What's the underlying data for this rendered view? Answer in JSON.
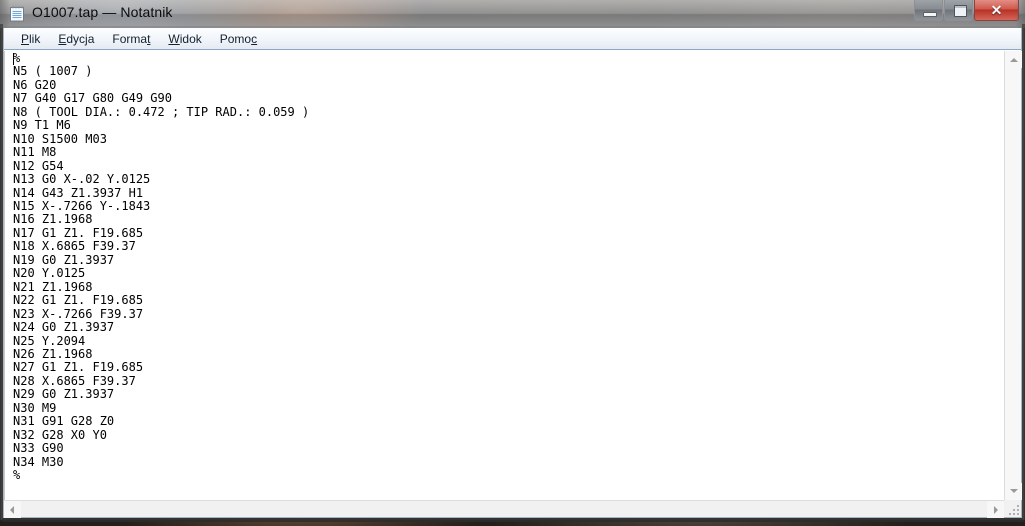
{
  "window": {
    "title": "O1007.tap — Notatnik",
    "icon": "notepad-icon",
    "caption_buttons": [
      {
        "name": "minimize",
        "label": "—"
      },
      {
        "name": "maximize",
        "label": "□"
      },
      {
        "name": "close",
        "label": "✕"
      }
    ]
  },
  "menubar": {
    "items": [
      {
        "label": "Plik",
        "mnemonic": "P"
      },
      {
        "label": "Edycja",
        "mnemonic": "E"
      },
      {
        "label": "Format",
        "mnemonic": "t"
      },
      {
        "label": "Widok",
        "mnemonic": "W"
      },
      {
        "label": "Pomoc",
        "mnemonic": "c"
      }
    ]
  },
  "editor": {
    "content": "%\nN5 ( 1007 )\nN6 G20\nN7 G40 G17 G80 G49 G90\nN8 ( TOOL DIA.: 0.472 ; TIP RAD.: 0.059 )\nN9 T1 M6\nN10 S1500 M03\nN11 M8\nN12 G54\nN13 G0 X-.02 Y.0125\nN14 G43 Z1.3937 H1\nN15 X-.7266 Y-.1843\nN16 Z1.1968\nN17 G1 Z1. F19.685\nN18 X.6865 F39.37\nN19 G0 Z1.3937\nN20 Y.0125\nN21 Z1.1968\nN22 G1 Z1. F19.685\nN23 X-.7266 F39.37\nN24 G0 Z1.3937\nN25 Y.2094\nN26 Z1.1968\nN27 G1 Z1. F19.685\nN28 X.6865 F39.37\nN29 G0 Z1.3937\nN30 M9\nN31 G91 G28 Z0\nN32 G28 X0 Y0\nN33 G90\nN34 M30\n%",
    "lines": [
      "%",
      "N5 ( 1007 )",
      "N6 G20",
      "N7 G40 G17 G80 G49 G90",
      "N8 ( TOOL DIA.: 0.472 ; TIP RAD.: 0.059 )",
      "N9 T1 M6",
      "N10 S1500 M03",
      "N11 M8",
      "N12 G54",
      "N13 G0 X-.02 Y.0125",
      "N14 G43 Z1.3937 H1",
      "N15 X-.7266 Y-.1843",
      "N16 Z1.1968",
      "N17 G1 Z1. F19.685",
      "N18 X.6865 F39.37",
      "N19 G0 Z1.3937",
      "N20 Y.0125",
      "N21 Z1.1968",
      "N22 G1 Z1. F19.685",
      "N23 X-.7266 F39.37",
      "N24 G0 Z1.3937",
      "N25 Y.2094",
      "N26 Z1.1968",
      "N27 G1 Z1. F19.685",
      "N28 X.6865 F39.37",
      "N29 G0 Z1.3937",
      "N30 M9",
      "N31 G91 G28 Z0",
      "N32 G28 X0 Y0",
      "N33 G90",
      "N34 M30",
      "%"
    ]
  },
  "scrollbars": {
    "vertical": {
      "up_arrow": "▲",
      "down_arrow": "▼"
    },
    "horizontal": {
      "left_arrow": "◄",
      "right_arrow": "►"
    }
  },
  "colors": {
    "close_button": "#b83225",
    "menu_separator": "#8ba7c4",
    "text": "#000000",
    "editor_background": "#ffffff"
  }
}
